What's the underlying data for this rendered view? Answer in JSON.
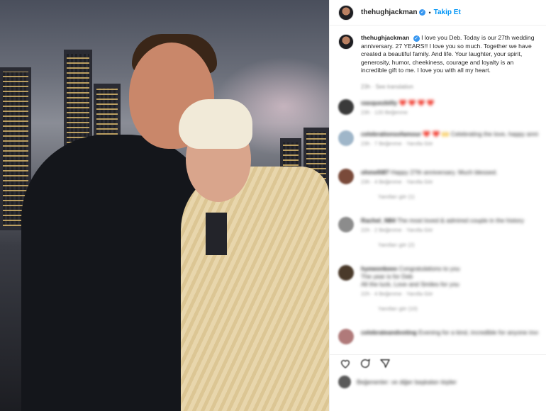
{
  "post": {
    "username": "thehughjackman",
    "verified_mark": "✓",
    "follow_separator": "•",
    "follow_label": "Takip Et",
    "caption": "I love you Deb. Today is our 27th wedding anniversary. 27 YEARS!! I love you so much. Together we have created a beautiful family. And life. Your laughter, your spirit, generosity, humor, cheekiness, courage and loyalty is an incredible gift to me. I love you with all my heart.",
    "caption_meta": "23h · See translation"
  },
  "comments": [
    {
      "user": "vasquezbilly",
      "text": "❤️ ❤️ ❤️ ❤️",
      "meta": "23h · 120 Beğenme",
      "replies": "",
      "avatar_color": "#3a3a3a"
    },
    {
      "user": "celebrationsofamour",
      "text": "❤️ ❤️ 🙌 Celebrating the love, happy anniversary",
      "meta": "23h · 7 Beğenme · Yanıtla Gör",
      "replies": "",
      "avatar_color": "#9fb6c9"
    },
    {
      "user": "ohmelli87",
      "text": "Happy 27th anniversary. Much blessed.",
      "meta": "23h · 4 Beğenme · Yanıtla Gör",
      "replies": "Yanıtları gör (1)",
      "avatar_color": "#7a4a3a"
    },
    {
      "user": "Rachel_N84",
      "text": "The most loved & admired couple in the history",
      "meta": "22h · 2 Beğenme · Yanıtla Gör",
      "replies": "Yanıtları gör (2)",
      "avatar_color": "#8c8c8c"
    },
    {
      "user": "hyewonkeee",
      "text": "Congratulations to you\nThe year is for Deb\nAll the luck, Love and Smiles for you",
      "meta": "22h · 4 Beğenme · Yanıtla Gör",
      "replies": "Yanıtları gör (10)",
      "avatar_color": "#4a3a2a"
    },
    {
      "user": "celebrateandvoting",
      "text": "Evening for a kind, incredible for anyone involved, a fairy tale story for you & your best something",
      "meta": "",
      "replies": "",
      "avatar_color": "#b07a7a"
    }
  ],
  "actions": {
    "like_icon": "heart-icon",
    "comment_icon": "comment-icon",
    "share_icon": "share-icon"
  },
  "liked_by": "Beğenenler: ve diğer başkaları kişiler",
  "colors": {
    "accent": "#0095f6",
    "verified": "#3897f0",
    "text": "#262626",
    "muted": "#8e8e8e"
  }
}
